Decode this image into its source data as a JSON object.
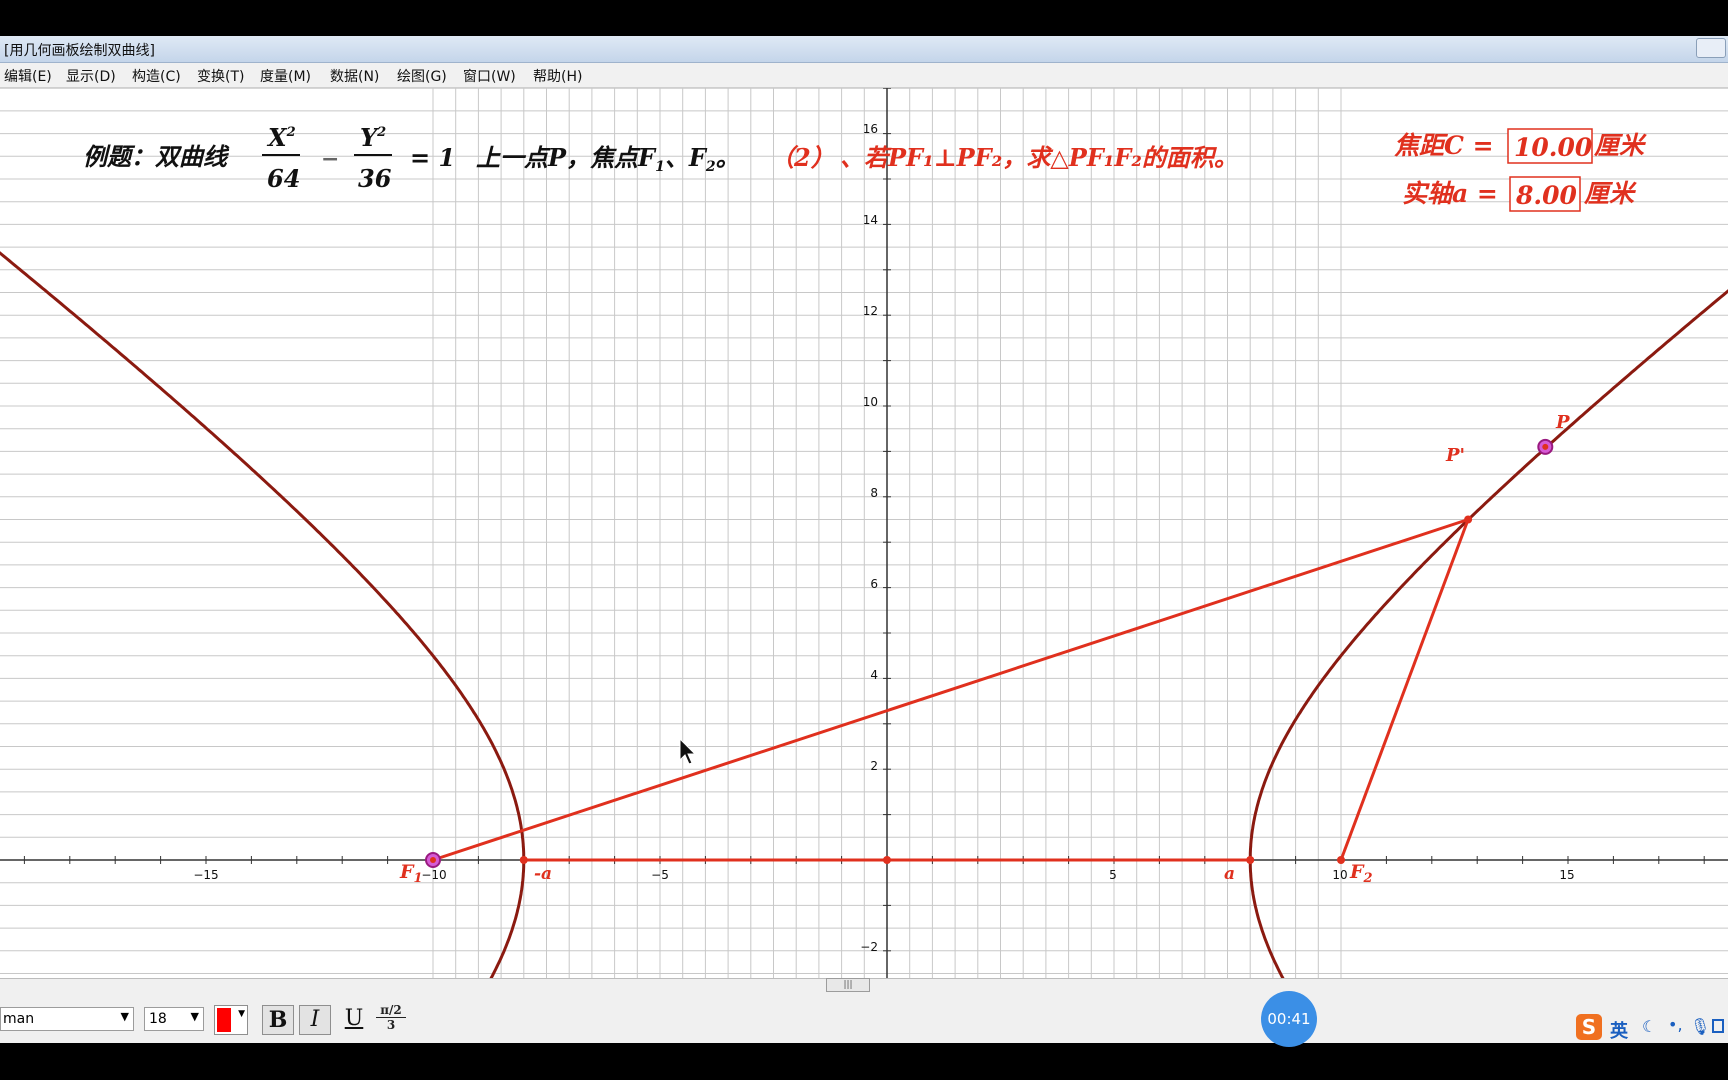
{
  "window": {
    "title": "[用几何画板绘制双曲线]"
  },
  "menu": [
    "编辑(E)",
    "显示(D)",
    "构造(C)",
    "变换(T)",
    "度量(M)",
    "数据(N)",
    "绘图(G)",
    "窗口(W)",
    "帮助(H)"
  ],
  "problem": {
    "prefix": "例题：双曲线",
    "num_x": "X",
    "exp": "2",
    "den_x": "64",
    "minus": "−",
    "num_y": "Y",
    "den_y": "36",
    "equals": "= 1",
    "text1": "上一点P，焦点F",
    "sub1": "1",
    "sep": "、F",
    "sub2": "2",
    "period": "。",
    "part": "（2）",
    "red_text": "、若PF₁⊥PF₂，求△PF₁F₂的面积。"
  },
  "measures": {
    "focal_label": "焦距C =",
    "focal_value": "10.00",
    "focal_unit": "厘米",
    "axis_label": "实轴a =",
    "axis_value": "8.00",
    "axis_unit": "厘米"
  },
  "graph": {
    "x_ticks": [
      "−15",
      "−10",
      "−5",
      "5",
      "10",
      "15"
    ],
    "y_ticks": [
      "16",
      "14",
      "12",
      "10",
      "8",
      "6",
      "4",
      "2",
      "−2"
    ],
    "hyperbola": {
      "a": 8,
      "b": 6
    },
    "points": {
      "F1": {
        "label": "F",
        "sub": "1",
        "x": -10,
        "y": 0
      },
      "F2": {
        "label": "F",
        "sub": "2",
        "x": 10,
        "y": 0
      },
      "minus_a": {
        "label": "-a",
        "x": -8,
        "y": 0
      },
      "a": {
        "label": "a",
        "x": 8,
        "y": 0
      },
      "O": {
        "x": 0,
        "y": 0
      },
      "P": {
        "label": "P",
        "x": 14.5,
        "y": 9.1
      },
      "P_prime": {
        "label": "P'",
        "x": 12.8,
        "y": 7.5
      }
    },
    "colors": {
      "curve": "#8b1a10",
      "construction": "#e0301e",
      "grid": "#c8c8c8",
      "axis": "#333333",
      "text": "#111111",
      "point_fill": "#d65ad6"
    }
  },
  "toolbar": {
    "font_name": "man",
    "font_size": "18",
    "bold": "B",
    "italic": "I",
    "underline": "U",
    "fraction": "π/2 / 3",
    "text_color": "#ff0000"
  },
  "recorder": {
    "time": "00:41"
  },
  "ime": {
    "lang": "英"
  }
}
